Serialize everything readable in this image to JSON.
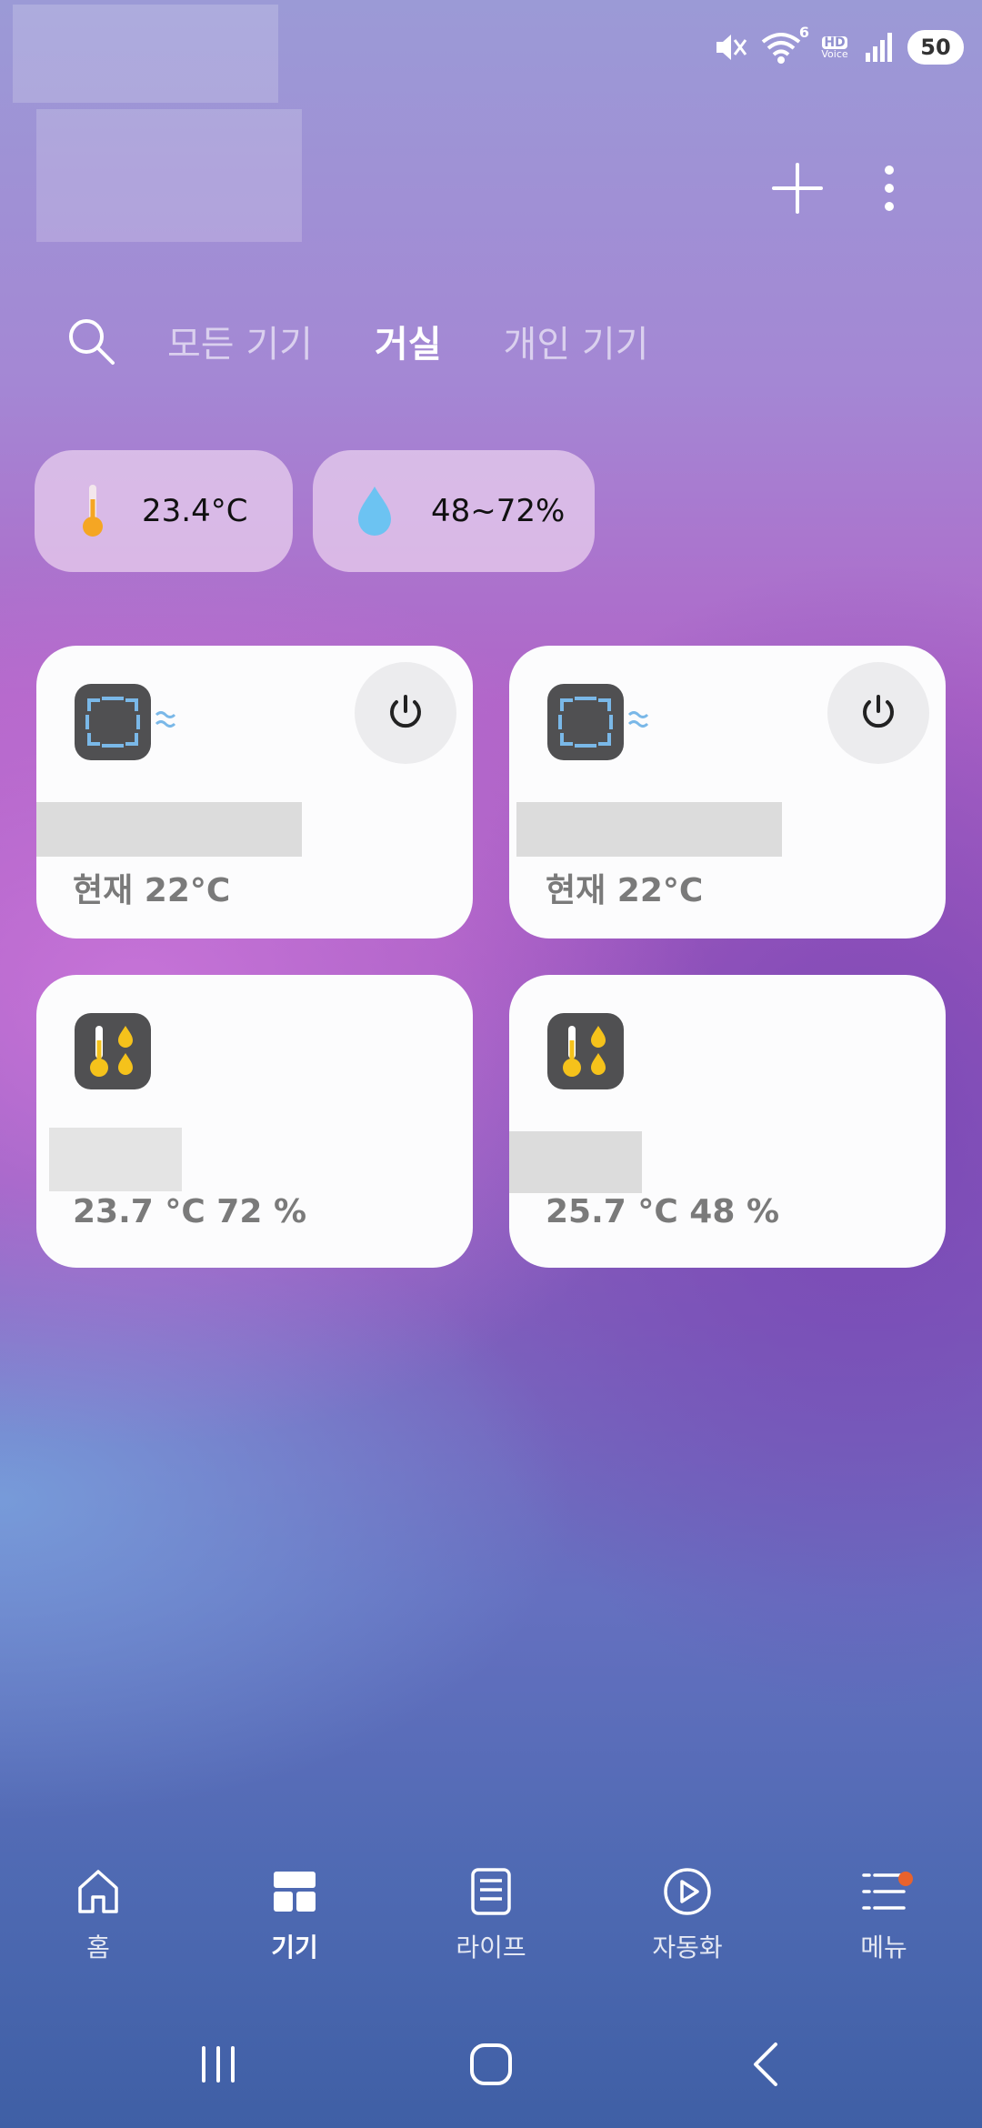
{
  "status_bar": {
    "icons": [
      "mute-icon",
      "wifi-icon",
      "hd-voice-icon",
      "signal-icon"
    ],
    "hd_label": "HD",
    "voice_label": "Voice",
    "wifi_badge": "6",
    "battery": "50"
  },
  "header": {
    "actions": [
      "plus-icon",
      "more-vertical-icon"
    ]
  },
  "tabs": [
    {
      "label": "모든 기기",
      "active": false
    },
    {
      "label": "거실",
      "active": true
    },
    {
      "label": "개인 기기",
      "active": false
    }
  ],
  "summary": {
    "temperature": "23.4°C",
    "humidity": "48~72%"
  },
  "devices": [
    {
      "type": "air-conditioner",
      "status": "현재 22°C",
      "has_power": true
    },
    {
      "type": "air-conditioner",
      "status": "현재 22°C",
      "has_power": true
    },
    {
      "type": "thermo-hygrometer",
      "status": "23.7 °C  72 %",
      "has_power": false
    },
    {
      "type": "thermo-hygrometer",
      "status": "25.7 °C  48 %",
      "has_power": false
    }
  ],
  "bottom_nav": [
    {
      "label": "홈",
      "icon": "home-icon",
      "active": false
    },
    {
      "label": "기기",
      "icon": "devices-icon",
      "active": true
    },
    {
      "label": "라이프",
      "icon": "life-icon",
      "active": false
    },
    {
      "label": "자동화",
      "icon": "automation-icon",
      "active": false
    },
    {
      "label": "메뉴",
      "icon": "menu-icon",
      "active": false,
      "badge": true
    }
  ],
  "colors": {
    "accent_badge": "#e8622c",
    "thermo_yellow": "#f5c21b",
    "water_blue": "#6cc3f2",
    "card_bg": "#fcfcfd"
  }
}
